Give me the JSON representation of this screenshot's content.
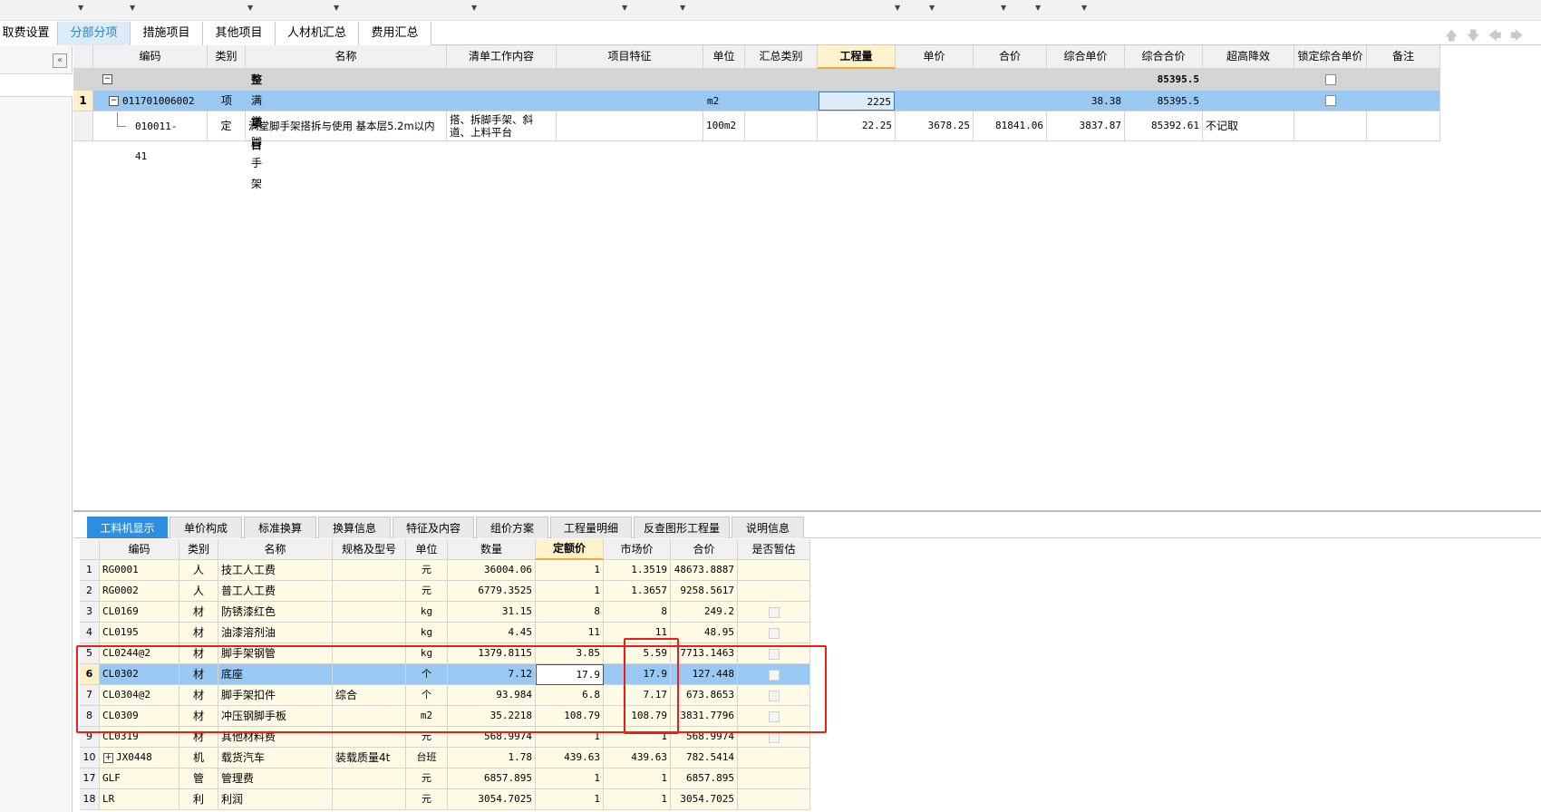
{
  "main_tabs": [
    {
      "label": "取费设置",
      "active": false
    },
    {
      "label": "分部分项",
      "active": true
    },
    {
      "label": "措施项目",
      "active": false
    },
    {
      "label": "其他项目",
      "active": false
    },
    {
      "label": "人材机汇总",
      "active": false
    },
    {
      "label": "费用汇总",
      "active": false
    }
  ],
  "collapse_icon": "«",
  "upper_grid": {
    "headers": [
      "编码",
      "类别",
      "名称",
      "清单工作内容",
      "项目特征",
      "单位",
      "汇总类别",
      "工程量",
      "单价",
      "合价",
      "综合单价",
      "综合合价",
      "超高降效",
      "锁定综合单价",
      "备注"
    ],
    "highlight_header": "工程量",
    "total_row": {
      "label": "整个项目",
      "total": "85395.5"
    },
    "rows": [
      {
        "num": "1",
        "code": "011701006002",
        "type": "项",
        "name": "满堂脚手架",
        "work": "",
        "feature": "",
        "unit": "m2",
        "sum_cat": "",
        "qty": "2225",
        "price": "",
        "amount": "",
        "comp_price": "38.38",
        "comp_amount": "85395.5",
        "height": ""
      },
      {
        "num": "",
        "code": "010011-41",
        "type": "定",
        "name": "满堂脚手架搭拆与使用 基本层5.2m以内",
        "work_line1": "搭、拆脚手架、斜",
        "work_line2": "道、上料平台",
        "feature": "",
        "unit": "100m2",
        "sum_cat": "",
        "qty": "22.25",
        "price": "3678.25",
        "amount": "81841.06",
        "comp_price": "3837.87",
        "comp_amount": "85392.61",
        "height": "不记取"
      }
    ]
  },
  "sub_tabs": [
    "工料机显示",
    "单价构成",
    "标准换算",
    "换算信息",
    "特征及内容",
    "组价方案",
    "工程量明细",
    "反查图形工程量",
    "说明信息"
  ],
  "lower_grid": {
    "headers": [
      "编码",
      "类别",
      "名称",
      "规格及型号",
      "单位",
      "数量",
      "定额价",
      "市场价",
      "合价",
      "是否暂估"
    ],
    "highlight_header": "定额价",
    "rows": [
      {
        "num": "1",
        "code": "RG0001",
        "type": "人",
        "name": "技工人工费",
        "spec": "",
        "unit": "元",
        "qty": "36004.06",
        "quota": "1",
        "market": "1.3519",
        "amount": "48673.8887",
        "est": false
      },
      {
        "num": "2",
        "code": "RG0002",
        "type": "人",
        "name": "普工人工费",
        "spec": "",
        "unit": "元",
        "qty": "6779.3525",
        "quota": "1",
        "market": "1.3657",
        "amount": "9258.5617",
        "est": false
      },
      {
        "num": "3",
        "code": "CL0169",
        "type": "材",
        "name": "防锈漆红色",
        "spec": "",
        "unit": "kg",
        "qty": "31.15",
        "quota": "8",
        "market": "8",
        "amount": "249.2",
        "est": true
      },
      {
        "num": "4",
        "code": "CL0195",
        "type": "材",
        "name": "油漆溶剂油",
        "spec": "",
        "unit": "kg",
        "qty": "4.45",
        "quota": "11",
        "market": "11",
        "amount": "48.95",
        "est": true
      },
      {
        "num": "5",
        "code": "CL0244@2",
        "type": "材",
        "name": "脚手架钢管",
        "spec": "",
        "unit": "kg",
        "qty": "1379.8115",
        "quota": "3.85",
        "market": "5.59",
        "amount": "7713.1463",
        "est": true
      },
      {
        "num": "6",
        "code": "CL0302",
        "type": "材",
        "name": "底座",
        "spec": "",
        "unit": "个",
        "qty": "7.12",
        "quota": "17.9",
        "market": "17.9",
        "amount": "127.448",
        "est": true
      },
      {
        "num": "7",
        "code": "CL0304@2",
        "type": "材",
        "name": "脚手架扣件",
        "spec": "综合",
        "unit": "个",
        "qty": "93.984",
        "quota": "6.8",
        "market": "7.17",
        "amount": "673.8653",
        "est": true
      },
      {
        "num": "8",
        "code": "CL0309",
        "type": "材",
        "name": "冲压钢脚手板",
        "spec": "",
        "unit": "m2",
        "qty": "35.2218",
        "quota": "108.79",
        "market": "108.79",
        "amount": "3831.7796",
        "est": true
      },
      {
        "num": "9",
        "code": "CL0319",
        "type": "材",
        "name": "其他材料费",
        "spec": "",
        "unit": "元",
        "qty": "568.9974",
        "quota": "1",
        "market": "1",
        "amount": "568.9974",
        "est": true
      },
      {
        "num": "10",
        "code": "JX0448",
        "type": "机",
        "name": "载货汽车",
        "spec": "装载质量4t",
        "unit": "台班",
        "qty": "1.78",
        "quota": "439.63",
        "market": "439.63",
        "amount": "782.5414",
        "est": false
      },
      {
        "num": "17",
        "code": "GLF",
        "type": "管",
        "name": "管理费",
        "spec": "",
        "unit": "元",
        "qty": "6857.895",
        "quota": "1",
        "market": "1",
        "amount": "6857.895",
        "est": false
      },
      {
        "num": "18",
        "code": "LR",
        "type": "利",
        "name": "利润",
        "spec": "",
        "unit": "元",
        "qty": "3054.7025",
        "quota": "1",
        "market": "1",
        "amount": "3054.7025",
        "est": false
      }
    ],
    "selected_row": "6"
  },
  "colors": {
    "accent_blue": "#2f8fde",
    "selected_row": "#99c9f3",
    "row_yellow": "#fffbe5",
    "highlight_header": "#fff3cc",
    "annotation_red": "#ee1c1c"
  }
}
